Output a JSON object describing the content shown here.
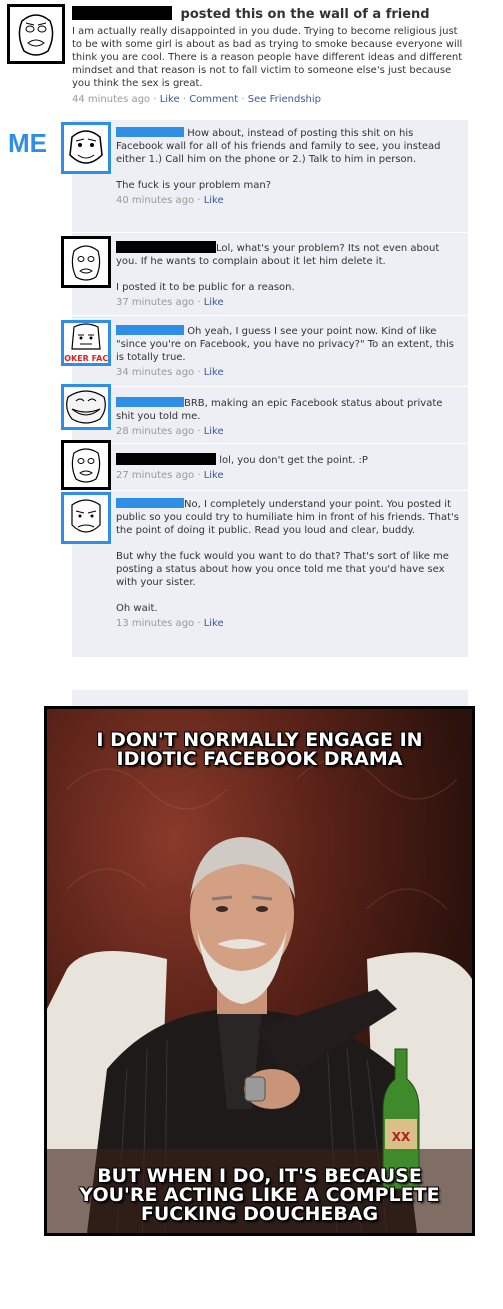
{
  "original_post": {
    "heading": "posted this on the wall of a friend",
    "body": "I am actually really disappointed in you dude. Trying to become religious just to be with some girl is about as bad as trying to smoke because everyone will think you are cool. There is a reason people have different ideas and different mindset and that reason is not to fall victim to someone else's just because you think the sex is great.",
    "time": "44 minutes ago",
    "actions": [
      "Like",
      "Comment",
      "See Friendship"
    ]
  },
  "me_label": "ME",
  "like_label": "Like",
  "comments": [
    {
      "avatar": "yao-ming-face",
      "texts": [
        "How about, instead of posting this shit on his Facebook wall for all of his friends and family to see, you instead either 1.) Call him on the phone or 2.) Talk to him in person.",
        "The fuck is your problem man?"
      ],
      "time": "40 minutes ago"
    },
    {
      "avatar": "troll-face-sketch",
      "texts": [
        "Lol, what's your problem? Its not even about you. If he wants to complain about it let him delete it.",
        "I posted it to be public for a reason."
      ],
      "time": "37 minutes ago"
    },
    {
      "avatar": "poker-face",
      "avatar_label": "POKER FACE",
      "texts": [
        "Oh yeah, I guess I see your point now. Kind of like \"since you're on Facebook, you have no privacy?\" To an extent, this is totally true."
      ],
      "time": "34 minutes ago"
    },
    {
      "avatar": "trollface",
      "texts": [
        "BRB, making an epic Facebook status about private shit you told me."
      ],
      "time": "28 minutes ago"
    },
    {
      "avatar": "troll-face-sketch",
      "texts": [
        "lol, you don't get the point. :P"
      ],
      "time": "27 minutes ago"
    },
    {
      "avatar": "fuck-that-face",
      "texts": [
        "No, I completely understand your point. You posted it public so you could try to humiliate him in front of his friends. That's the point of doing it public. Read you loud and clear, buddy.",
        "But why the fuck would you want to do that? That's sort of like me posting a status about how you once told me that you'd have sex with your sister.",
        "Oh wait."
      ],
      "time": "13 minutes ago"
    }
  ],
  "meme": {
    "top_text": "I DON'T NORMALLY ENGAGE IN IDIOTIC FACEBOOK DRAMA",
    "bottom_text": "BUT WHEN I DO, IT'S BECAUSE YOU'RE ACTING LIKE A COMPLETE FUCKING DOUCHEBAG",
    "bottle_label": "XX"
  },
  "colors": {
    "facebook_link": "#3b5998",
    "comment_bg": "#edeff4",
    "me_blue": "#2f8fe6"
  }
}
